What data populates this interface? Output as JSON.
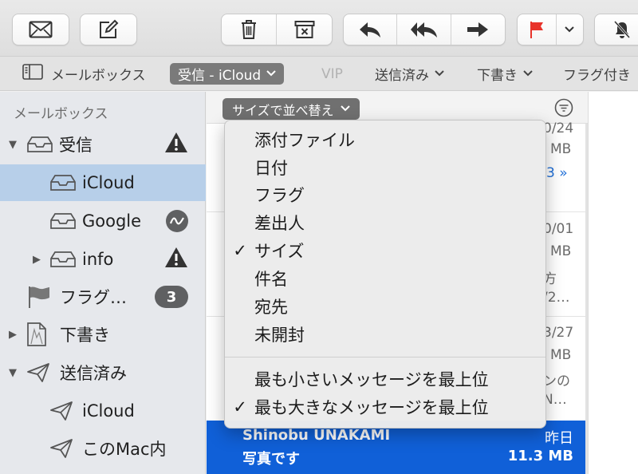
{
  "favorites": {
    "mailboxes_label": "メールボックス",
    "active_label": "受信 - iCloud",
    "vip_label": "VIP",
    "sent_label": "送信済み",
    "drafts_label": "下書き",
    "flagged_label": "フラグ付き"
  },
  "sidebar": {
    "header": "メールボックス",
    "items": [
      {
        "label": "受信",
        "badge": ""
      },
      {
        "label": "iCloud",
        "badge": ""
      },
      {
        "label": "Google",
        "badge": ""
      },
      {
        "label": "info",
        "badge": ""
      },
      {
        "label": "フラグ…",
        "badge": "3"
      },
      {
        "label": "下書き",
        "badge": ""
      },
      {
        "label": "送信済み",
        "badge": ""
      },
      {
        "label": "iCloud",
        "badge": ""
      },
      {
        "label": "このMac内",
        "badge": ""
      }
    ]
  },
  "message_list": {
    "sort_label": "サイズで並べ替え",
    "row1": {
      "date": "0/24",
      "size": "MB",
      "thread": "3 »"
    },
    "row2": {
      "date": "0/01",
      "size": "MB",
      "snippet1": "方",
      "snippet2": "/2…"
    },
    "row3": {
      "date": "3/27",
      "size": "MB",
      "snippet1": "ンの",
      "snippet2": "N…"
    },
    "selected": {
      "from": "Shinobu UNAKAMI",
      "date": "昨日",
      "subject": "写真です",
      "size": "11.3 MB"
    }
  },
  "sort_menu": {
    "items": [
      {
        "label": "添付ファイル",
        "checked": false
      },
      {
        "label": "日付",
        "checked": false
      },
      {
        "label": "フラグ",
        "checked": false
      },
      {
        "label": "差出人",
        "checked": false
      },
      {
        "label": "サイズ",
        "checked": true
      },
      {
        "label": "件名",
        "checked": false
      },
      {
        "label": "宛先",
        "checked": false
      },
      {
        "label": "未開封",
        "checked": false
      }
    ],
    "order_items": [
      {
        "label": "最も小さいメッセージを最上位",
        "checked": false
      },
      {
        "label": "最も大きなメッセージを最上位",
        "checked": true
      }
    ],
    "check_glyph": "✓"
  },
  "colors": {
    "accent_blue": "#1060d8",
    "sidebar_selection": "#b7cfe9",
    "flag_red": "#e8332a"
  }
}
